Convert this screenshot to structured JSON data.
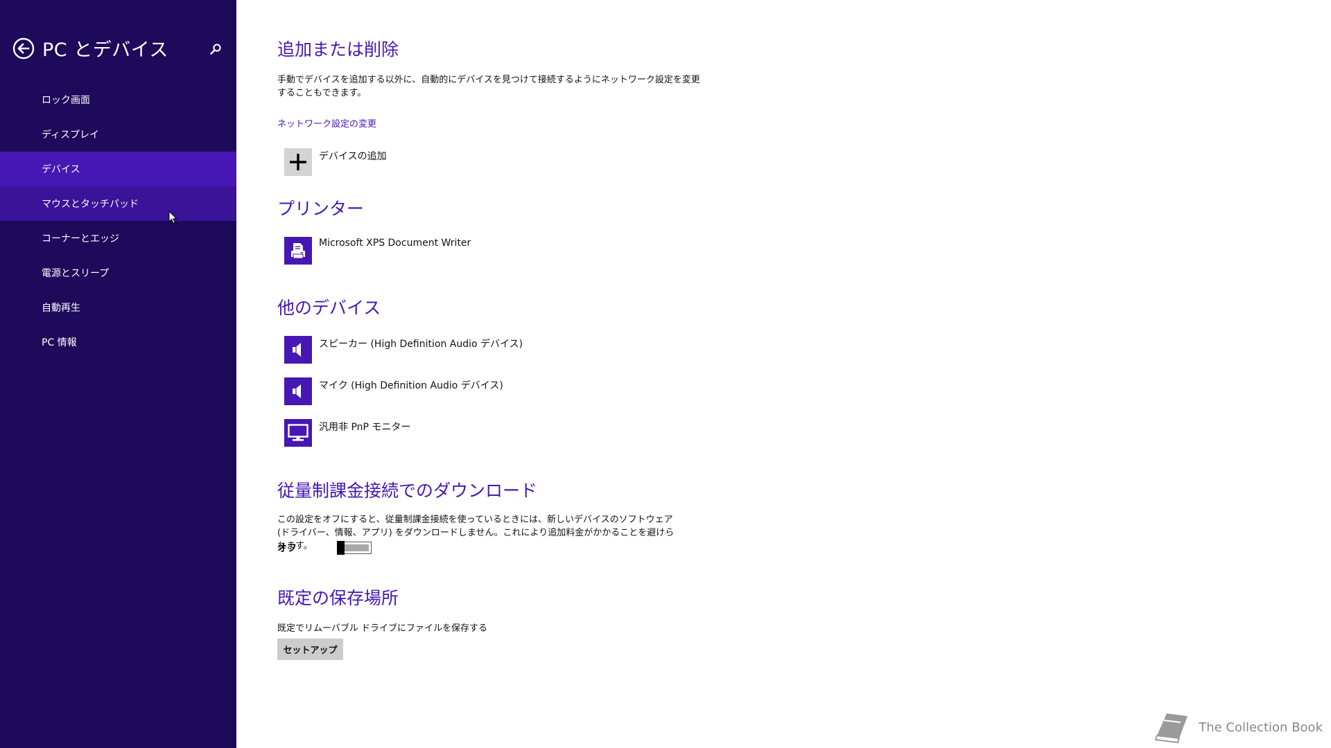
{
  "sidebar": {
    "title": "PC とデバイス",
    "items": [
      {
        "label": "ロック画面"
      },
      {
        "label": "ディスプレイ"
      },
      {
        "label": "デバイス"
      },
      {
        "label": "マウスとタッチパッド"
      },
      {
        "label": "コーナーとエッジ"
      },
      {
        "label": "電源とスリープ"
      },
      {
        "label": "自動再生"
      },
      {
        "label": "PC 情報"
      }
    ],
    "active_index": 2,
    "hover_index": 3
  },
  "add_remove": {
    "heading": "追加または削除",
    "description": "手動でデバイスを追加する以外に、自動的にデバイスを見つけて接続するようにネットワーク設定を変更することもできます。",
    "link": "ネットワーク設定の変更",
    "add_device_label": "デバイスの追加"
  },
  "printers": {
    "heading": "プリンター",
    "items": [
      {
        "label": "Microsoft XPS Document Writer",
        "icon": "printer-icon"
      }
    ]
  },
  "other_devices": {
    "heading": "他のデバイス",
    "items": [
      {
        "label": "スピーカー (High Definition Audio デバイス)",
        "icon": "speaker-icon"
      },
      {
        "label": "マイク (High Definition Audio デバイス)",
        "icon": "speaker-icon"
      },
      {
        "label": "汎用非 PnP モニター",
        "icon": "monitor-icon"
      }
    ]
  },
  "metered": {
    "heading": "従量制課金接続でのダウンロード",
    "description": "この設定をオフにすると、従量制課金接続を使っているときには、新しいデバイスのソフトウェア (ドライバー、情報、アプリ) をダウンロードしません。これにより追加料金がかかることを避けられます。",
    "toggle_label": "オフ",
    "toggle_on": false
  },
  "default_save": {
    "heading": "既定の保存場所",
    "description": "既定でリムーバブル ドライブにファイルを保存する",
    "button_label": "セットアップ"
  },
  "watermark": {
    "text": "The Collection Book"
  },
  "colors": {
    "sidebar_bg": "#1e0a5a",
    "accent": "#4617b4",
    "hover": "#3a1398"
  }
}
